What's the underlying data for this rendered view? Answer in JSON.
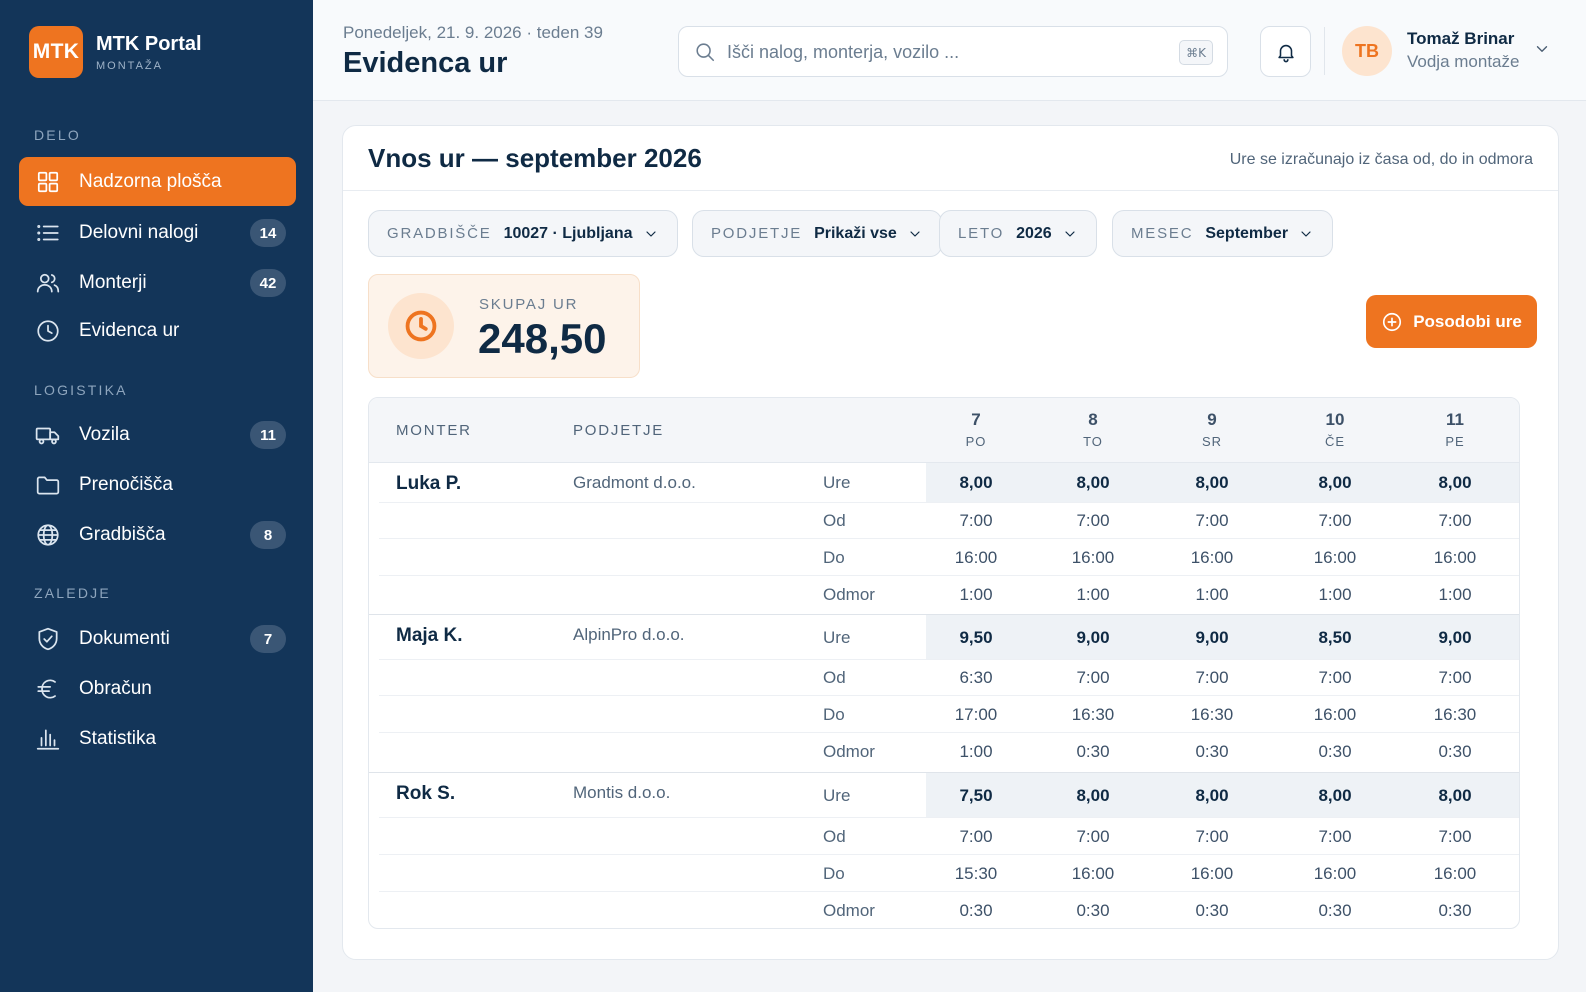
{
  "brand": {
    "logo_text": "MTK",
    "title": "MTK Portal",
    "subtitle": "MONTAŽA"
  },
  "sidebar": {
    "sections": [
      {
        "label": "DELO",
        "items": [
          {
            "label": "Nadzorna plošča",
            "icon": "dashboard-grid-icon",
            "active": true
          },
          {
            "label": "Delovni nalogi",
            "icon": "list-icon",
            "badge": "14"
          },
          {
            "label": "Monterji",
            "icon": "users-icon",
            "badge": "42"
          },
          {
            "label": "Evidenca ur",
            "icon": "clock-icon"
          }
        ]
      },
      {
        "label": "LOGISTIKA",
        "items": [
          {
            "label": "Vozila",
            "icon": "truck-icon",
            "badge": "11"
          },
          {
            "label": "Prenočišča",
            "icon": "folder-icon"
          },
          {
            "label": "Gradbišča",
            "icon": "globe-icon",
            "badge": "8"
          }
        ]
      },
      {
        "label": "ZALEDJE",
        "items": [
          {
            "label": "Dokumenti",
            "icon": "shield-check-icon",
            "badge": "7"
          },
          {
            "label": "Obračun",
            "icon": "euro-icon"
          },
          {
            "label": "Statistika",
            "icon": "bar-chart-icon"
          }
        ]
      }
    ]
  },
  "header": {
    "date_line": "Ponedeljek, 21. 9. 2026 · teden 39",
    "title": "Evidenca ur",
    "search_placeholder": "Išči nalog, monterja, vozilo ...",
    "search_shortcut": "⌘K",
    "user": {
      "initials": "TB",
      "name": "Tomaž Brinar",
      "role": "Vodja montaže"
    }
  },
  "card": {
    "title": "Vnos ur — september 2026",
    "hint": "Ure se izračunajo iz časa od, do in odmora",
    "filters": [
      {
        "key": "GRADBIŠČE",
        "value": "10027 · Ljubljana"
      },
      {
        "key": "PODJETJE",
        "value": "Prikaži vse"
      },
      {
        "key": "LETO",
        "value": "2026"
      },
      {
        "key": "MESEC",
        "value": "September"
      }
    ],
    "total": {
      "label": "SKUPAJ UR",
      "value": "248,50"
    },
    "update_button": "Posodobi ure"
  },
  "table": {
    "headers": {
      "worker": "MONTER",
      "company": "PODJETJE"
    },
    "days": [
      {
        "num": "7",
        "dow": "PO"
      },
      {
        "num": "8",
        "dow": "TO"
      },
      {
        "num": "9",
        "dow": "SR"
      },
      {
        "num": "10",
        "dow": "ČE"
      },
      {
        "num": "11",
        "dow": "PE"
      }
    ],
    "row_labels": [
      "Ure",
      "Od",
      "Do",
      "Odmor"
    ],
    "workers": [
      {
        "name": "Luka P.",
        "company": "Gradmont d.o.o.",
        "ure": [
          "8,00",
          "8,00",
          "8,00",
          "8,00",
          "8,00"
        ],
        "od": [
          "7:00",
          "7:00",
          "7:00",
          "7:00",
          "7:00"
        ],
        "do": [
          "16:00",
          "16:00",
          "16:00",
          "16:00",
          "16:00"
        ],
        "odmor": [
          "1:00",
          "1:00",
          "1:00",
          "1:00",
          "1:00"
        ]
      },
      {
        "name": "Maja K.",
        "company": "AlpinPro d.o.o.",
        "ure": [
          "9,50",
          "9,00",
          "9,00",
          "8,50",
          "9,00"
        ],
        "od": [
          "6:30",
          "7:00",
          "7:00",
          "7:00",
          "7:00"
        ],
        "do": [
          "17:00",
          "16:30",
          "16:30",
          "16:00",
          "16:30"
        ],
        "odmor": [
          "1:00",
          "0:30",
          "0:30",
          "0:30",
          "0:30"
        ]
      },
      {
        "name": "Rok S.",
        "company": "Montis d.o.o.",
        "ure": [
          "7,50",
          "8,00",
          "8,00",
          "8,00",
          "8,00"
        ],
        "od": [
          "7:00",
          "7:00",
          "7:00",
          "7:00",
          "7:00"
        ],
        "do": [
          "15:30",
          "16:00",
          "16:00",
          "16:00",
          "16:00"
        ],
        "odmor": [
          "0:30",
          "0:30",
          "0:30",
          "0:30",
          "0:30"
        ]
      }
    ]
  }
}
